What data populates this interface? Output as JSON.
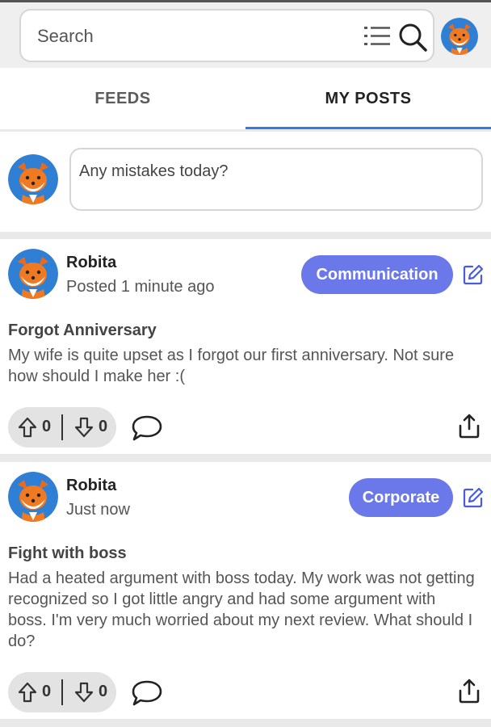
{
  "search": {
    "placeholder": "Search"
  },
  "tabs": [
    {
      "label": "FEEDS"
    },
    {
      "label": "MY POSTS"
    }
  ],
  "composer": {
    "placeholder": "Any mistakes today?"
  },
  "posts": [
    {
      "author": "Robita",
      "time": "Posted 1 minute ago",
      "category": "Communication",
      "title": "Forgot Anniversary",
      "body": "My wife is quite upset as I forgot our first anniversary. Not sure how should I make her :(",
      "upvotes": "0",
      "downvotes": "0"
    },
    {
      "author": "Robita",
      "time": "Just now",
      "category": "Corporate",
      "title": "Fight with boss",
      "body": "Had a heated argument with boss today. My work was not getting recognized so I got little angry and had some argument with boss. I'm very much worried about my next review. What should I do?",
      "upvotes": "0",
      "downvotes": "0"
    }
  ],
  "colors": {
    "accent": "#3a78e0",
    "category_bg": "#6b78ea",
    "edit_icon": "#4a5be0"
  },
  "icons": [
    "list-icon",
    "search-icon",
    "avatar-fox",
    "edit-icon",
    "upvote-arrow-icon",
    "downvote-arrow-icon",
    "comment-icon",
    "share-icon"
  ]
}
